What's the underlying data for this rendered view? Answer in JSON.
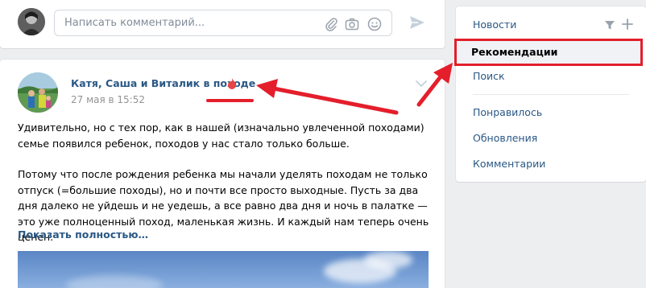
{
  "comment_bar": {
    "placeholder": "Написать комментарий..."
  },
  "post": {
    "author": "Катя, Саша и Виталик в походе",
    "date": "27 мая в 15:52",
    "paragraph1": "Удивительно, но с тех пор, как в нашей (изначально увлеченной походами) семье появился ребенок, походов у нас стало только больше.",
    "paragraph2": "Потому что после рождения ребенка мы начали уделять походам не только отпуск (=большие походы), но и почти все просто выходные. Пусть за два дня далеко не уйдешь и не уедешь, а все равно два дня и ночь в палатке — это уже полноценный поход, маленькая жизнь. И каждый нам теперь очень ценен.",
    "show_more": "Показать полностью…"
  },
  "nav": {
    "news": "Новости",
    "recommendations": "Рекомендации",
    "search": "Поиск",
    "liked": "Понравилось",
    "updates": "Обновления",
    "comments": "Комментарии"
  },
  "colors": {
    "link": "#2a5885",
    "annotation_red": "#e41e2b",
    "fire": "#e64646"
  }
}
